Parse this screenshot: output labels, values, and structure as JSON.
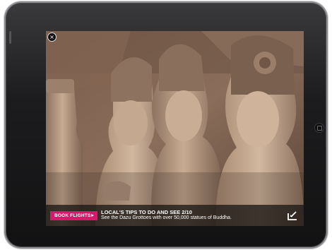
{
  "device": {
    "name": "iPad"
  },
  "screen": {
    "image": {
      "subject": "Dazu Grottoes Buddha statues",
      "colors": {
        "stone": "#b79a80",
        "shadow": "#5a463a",
        "cliff": "#7a6453"
      }
    },
    "close_icon": "close-icon",
    "close_glyph": "×"
  },
  "bottom_bar": {
    "book_flights_label": "BOOK FLIGHTS",
    "book_flights_color": "#d8196b",
    "tip_title": "LOCAL'S TIPS TO DO AND SEE 2/10",
    "tip_text": "See the Dazu Grottoes with over 50,000 statues of Buddha.",
    "share_icon": "share-arrow-icon"
  }
}
